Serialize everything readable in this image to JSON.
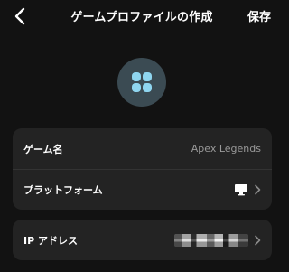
{
  "header": {
    "title": "ゲームプロファイルの作成",
    "save_label": "保存",
    "back_icon": "chevron-left-icon"
  },
  "avatar": {
    "icon": "grid-four-icon",
    "bg_color": "#3b4b53",
    "accent_color": "#8fd6f0"
  },
  "profile_rows": [
    {
      "label": "ゲーム名",
      "value": "Apex Legends"
    },
    {
      "label": "プラットフォーム",
      "value_icon": "monitor-icon"
    }
  ],
  "network_rows": [
    {
      "label": "IP アドレス",
      "value_obscured": true
    }
  ],
  "colors": {
    "background": "#121212",
    "card": "#232323",
    "text": "#ffffff",
    "muted": "#9a9a9a"
  }
}
